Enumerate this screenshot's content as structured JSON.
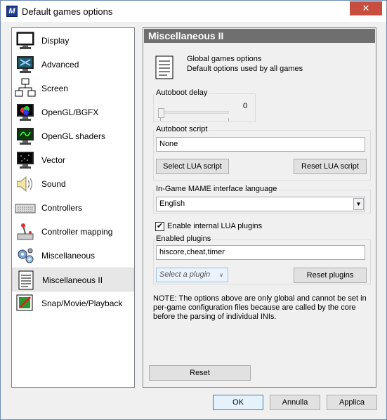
{
  "window": {
    "title": "Default games options",
    "app_icon_letter": "M",
    "close_glyph": "✕"
  },
  "sidebar": {
    "items": [
      {
        "label": "Display",
        "icon": "display-monitor-icon"
      },
      {
        "label": "Advanced",
        "icon": "advanced-monitor-icon"
      },
      {
        "label": "Screen",
        "icon": "screens-network-icon"
      },
      {
        "label": "OpenGL/BGFX",
        "icon": "opengl-monitor-icon"
      },
      {
        "label": "OpenGL shaders",
        "icon": "shader-monitor-icon"
      },
      {
        "label": "Vector",
        "icon": "vector-monitor-icon"
      },
      {
        "label": "Sound",
        "icon": "speaker-icon"
      },
      {
        "label": "Controllers",
        "icon": "keyboard-icon"
      },
      {
        "label": "Controller mapping",
        "icon": "joystick-icon"
      },
      {
        "label": "Miscellaneous",
        "icon": "gears-icon"
      },
      {
        "label": "Miscellaneous II",
        "icon": "document-icon",
        "selected": true
      },
      {
        "label": "Snap/Movie/Playback",
        "icon": "snapshot-icon"
      }
    ]
  },
  "panel": {
    "title": "Miscellaneous II",
    "global_title": "Global games options",
    "global_subtitle": "Default options used by all games",
    "autoboot_delay": {
      "label": "Autoboot delay",
      "value": "0"
    },
    "autoboot_script": {
      "label": "Autoboot script",
      "value": "None",
      "select_button": "Select LUA script",
      "reset_button": "Reset LUA script"
    },
    "language": {
      "label": "In-Game MAME interface language",
      "value": "English"
    },
    "enable_plugins": {
      "label": "Enable internal LUA plugins",
      "checked": true,
      "check_glyph": "✔"
    },
    "enabled_plugins": {
      "label": "Enabled plugins",
      "value": "hiscore,cheat,timer",
      "select_placeholder": "Select a plugin",
      "reset_button": "Reset plugins"
    },
    "note": "NOTE: The options above are only global and cannot be set in per-game configuration files because are called by the core before the parsing of individual INIs.",
    "reset_button": "Reset"
  },
  "footer": {
    "ok": "OK",
    "cancel": "Annulla",
    "apply": "Applica"
  },
  "colors": {
    "title_bar": "#6f6f6f",
    "close": "#c74e3f",
    "selected": "#e7e7e7",
    "accent": "#3c7fb1"
  }
}
